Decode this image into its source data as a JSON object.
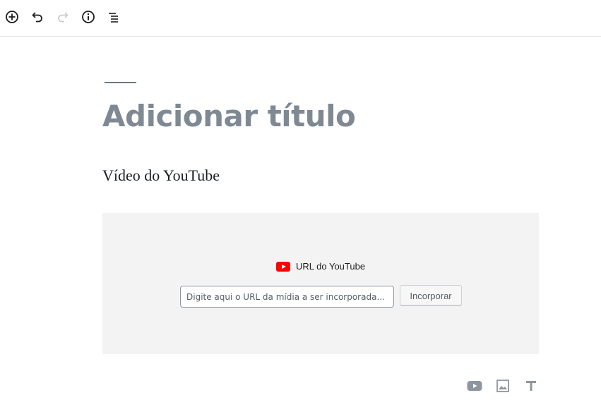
{
  "toolbar": {
    "icons": [
      "plus-circle-icon",
      "undo-icon",
      "redo-icon",
      "info-icon",
      "list-view-icon"
    ],
    "redo_disabled": true
  },
  "editor": {
    "title_placeholder": "Adicionar título",
    "block_heading": "Vídeo do YouTube",
    "embed": {
      "label": "URL do YouTube",
      "input_placeholder": "Digite aqui o URL da mídia a ser incorporada...",
      "input_value": "",
      "button_label": "Incorporar"
    }
  },
  "inserter": {
    "icons": [
      "youtube-icon",
      "image-icon",
      "text-icon"
    ]
  },
  "colors": {
    "youtube_red": "#ff0000",
    "title_gray": "#7e8993",
    "icon_gray": "#8d96a0",
    "placeholder_bg": "#f3f3f3"
  }
}
